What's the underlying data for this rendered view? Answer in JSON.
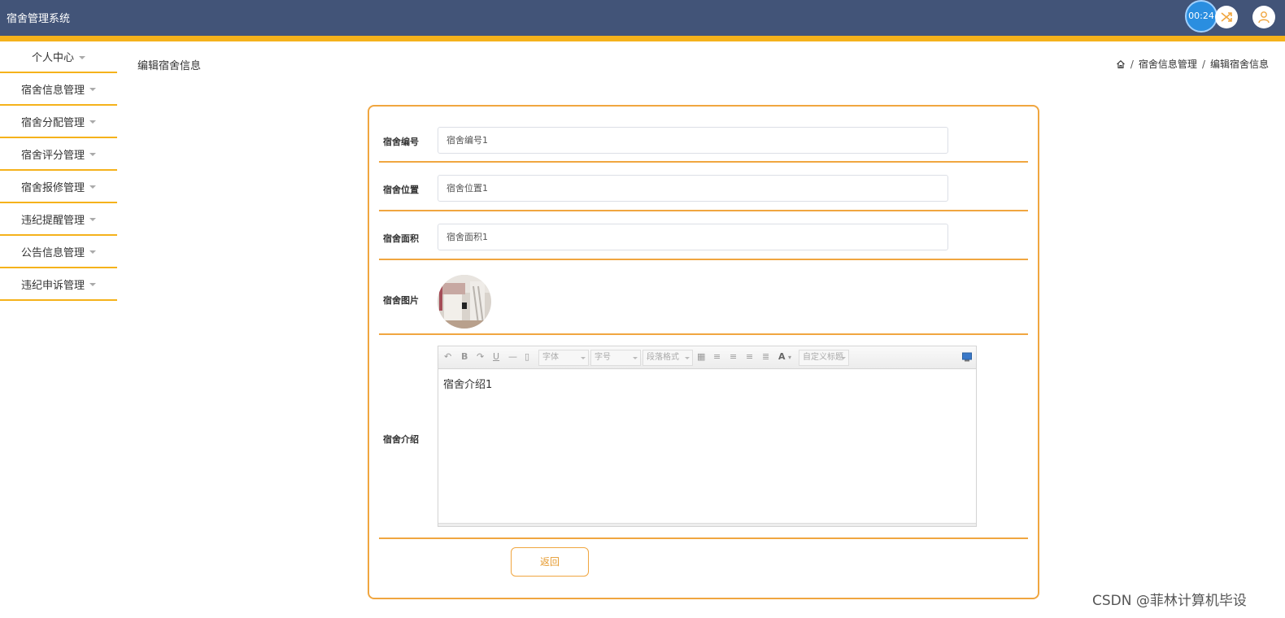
{
  "app": {
    "title": "宿舍管理系统",
    "timer": "00:24"
  },
  "sidebar": {
    "items": [
      {
        "label": "个人中心"
      },
      {
        "label": "宿舍信息管理"
      },
      {
        "label": "宿舍分配管理"
      },
      {
        "label": "宿舍评分管理"
      },
      {
        "label": "宿舍报修管理"
      },
      {
        "label": "违纪提醒管理"
      },
      {
        "label": "公告信息管理"
      },
      {
        "label": "违纪申诉管理"
      }
    ]
  },
  "page": {
    "title": "编辑宿舍信息",
    "breadcrumb": [
      "宿舍信息管理",
      "编辑宿舍信息"
    ]
  },
  "form": {
    "dorm_number": {
      "label": "宿舍编号",
      "value": "宿舍编号1"
    },
    "dorm_location": {
      "label": "宿舍位置",
      "value": "宿舍位置1"
    },
    "dorm_area": {
      "label": "宿舍面积",
      "value": "宿舍面积1"
    },
    "dorm_image": {
      "label": "宿舍图片"
    },
    "dorm_intro": {
      "label": "宿舍介绍",
      "value": "宿舍介绍1",
      "toolbar": {
        "font": "字体",
        "size": "字号",
        "paragraph": "段落格式",
        "custom_title": "自定义标题"
      }
    },
    "back_label": "返回"
  },
  "watermark": "CSDN @菲林计算机毕设",
  "colors": {
    "topbar": "#425478",
    "accent": "#f5b21b",
    "card_border": "#f0a640"
  }
}
